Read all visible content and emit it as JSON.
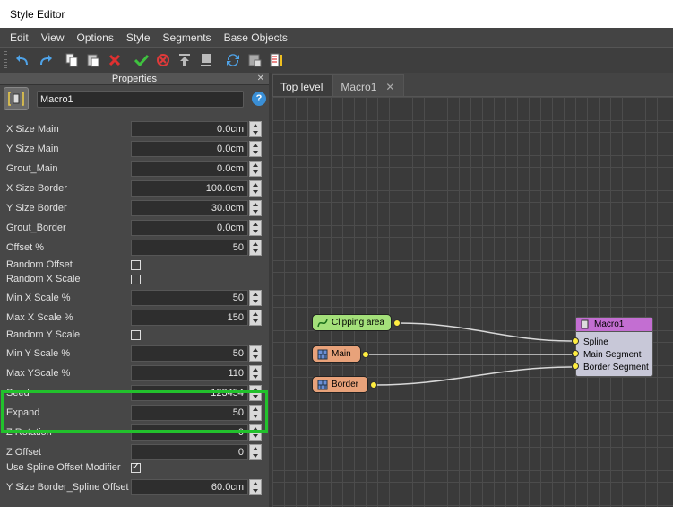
{
  "window": {
    "title": "Style Editor"
  },
  "menu": [
    "Edit",
    "View",
    "Options",
    "Style",
    "Segments",
    "Base Objects"
  ],
  "toolbar": {
    "icons": [
      "undo-icon",
      "redo-icon",
      "copy-icon",
      "paste-icon",
      "delete-icon",
      "apply-icon",
      "cancel-icon",
      "move-top-icon",
      "move-bottom-icon",
      "refresh-icon",
      "export-icon",
      "notes-icon"
    ]
  },
  "properties": {
    "header": "Properties",
    "name_value": "Macro1",
    "rows": [
      {
        "label": "X Size Main",
        "value": "0.0cm"
      },
      {
        "label": "Y  Size  Main",
        "value": "0.0cm"
      },
      {
        "label": "Grout_Main",
        "value": "0.0cm"
      },
      {
        "label": "X Size Border",
        "value": "100.0cm"
      },
      {
        "label": " Y  Size Border",
        "value": "30.0cm"
      },
      {
        "label": "Grout_Border",
        "value": "0.0cm"
      },
      {
        "label": "Offset %",
        "value": "50"
      },
      {
        "label": "Random Offset",
        "checked": false
      },
      {
        "label": "Random X Scale",
        "checked": false
      },
      {
        "label": "Min X Scale %",
        "value": "50"
      },
      {
        "label": "Max X Scale %",
        "value": "150"
      },
      {
        "label": "Random Y Scale",
        "checked": false
      },
      {
        "label": "Min Y Scale %",
        "value": "50"
      },
      {
        "label": "Max YScale %",
        "value": "110"
      },
      {
        "label": "Seed",
        "value": "123454"
      },
      {
        "label": "Expand",
        "value": "50"
      },
      {
        "label": "Z Rotation",
        "value": "0"
      },
      {
        "label": "Z Offset",
        "value": "0"
      },
      {
        "label": "Use Spline Offset Modifier",
        "checked": true
      },
      {
        "label": " Y  Size Border_Spline Offset",
        "value": "60.0cm"
      }
    ]
  },
  "tabs": [
    {
      "label": "Top level",
      "active": true
    },
    {
      "label": "Macro1",
      "active": false
    }
  ],
  "graph": {
    "nodes": {
      "clipping": "Clipping area",
      "main": "Main",
      "border": "Border",
      "macro": "Macro1"
    },
    "macro_ports": [
      "Spline",
      "Main Segment",
      "Border Segment"
    ]
  },
  "colors": {
    "highlight": "#22c12c",
    "clip_node": "#a4e07a",
    "shape_node": "#e8a27a",
    "macro_header": "#c36ed2",
    "port": "#ffee40"
  }
}
